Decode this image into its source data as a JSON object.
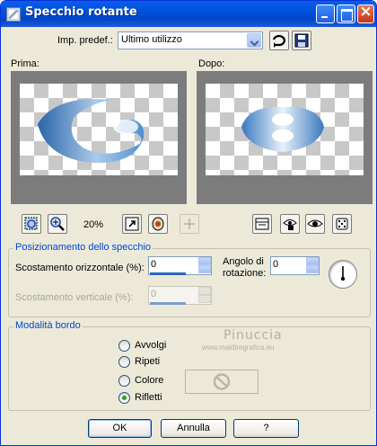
{
  "title": "Specchio rotante",
  "window_buttons": {
    "minimize": "",
    "maximize": "",
    "close": ""
  },
  "preset": {
    "label": "Imp. predef.:",
    "value": "Ultimo utilizzo"
  },
  "previews": {
    "before_label": "Prima:",
    "after_label": "Dopo:"
  },
  "zoom": {
    "value": "20%"
  },
  "mirror_group": {
    "title": "Posizionamento dello specchio",
    "h_offset_label": "Scostamento orizzontale (%):",
    "h_offset_value": "0",
    "angle_label_1": "Angolo di",
    "angle_label_2": "rotazione:",
    "angle_value": "0",
    "v_offset_label": "Scostamento verticale (%):",
    "v_offset_value": "0"
  },
  "edge_group": {
    "title": "Modalità bordo",
    "options": [
      "Avvolgi",
      "Ripeti",
      "Colore",
      "Rifletti"
    ],
    "selected": "Rifletti"
  },
  "watermark": {
    "name": "Pinuccia",
    "url": "www.maidiregrafica.eu"
  },
  "footer": {
    "ok": "OK",
    "cancel": "Annulla",
    "help": "?"
  },
  "colors": {
    "titlebar": "#0054e3",
    "dialog": "#ece9d8",
    "group_title": "#0046d5"
  },
  "icons": [
    "save-icon",
    "reset-icon",
    "zoom-fit-icon",
    "zoom-in-icon",
    "proof-icon",
    "visibility-icon",
    "pan-icon",
    "randomize-icon"
  ]
}
